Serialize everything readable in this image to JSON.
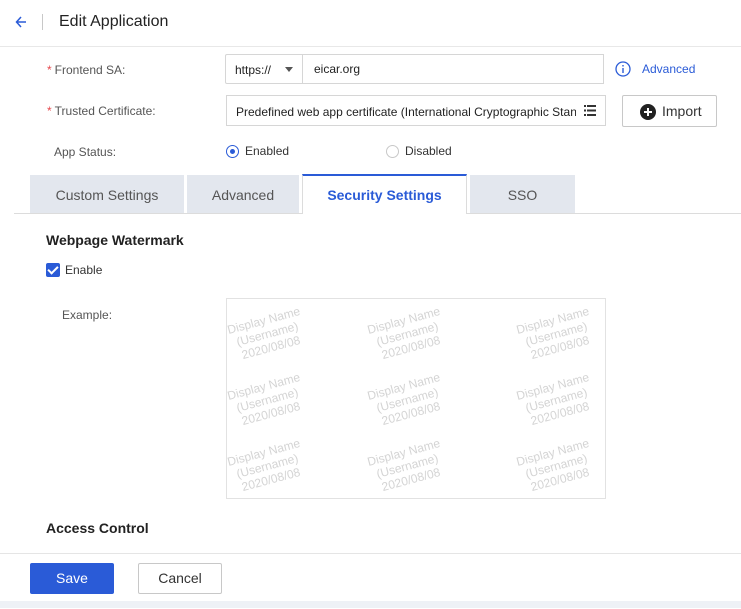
{
  "header": {
    "back_icon": "arrow-left-icon",
    "title": "Edit Application"
  },
  "form": {
    "frontend_sa": {
      "label": "Frontend SA:",
      "protocol": "https://",
      "domain": "eicar.org",
      "advanced_link": "Advanced",
      "info_icon": "info-circle-icon"
    },
    "trusted_certificate": {
      "label": "Trusted Certificate:",
      "value": "Predefined web app certificate (International Cryptographic Stan",
      "list_icon": "list-icon",
      "import_button": "Import",
      "import_icon": "plus-circle-icon"
    },
    "app_status": {
      "label": "App Status:",
      "options": [
        "Enabled",
        "Disabled"
      ],
      "selected": "Enabled"
    }
  },
  "tabs": [
    {
      "label": "Custom Settings",
      "active": false
    },
    {
      "label": "Advanced",
      "active": false
    },
    {
      "label": "Security Settings",
      "active": true
    },
    {
      "label": "SSO",
      "active": false
    }
  ],
  "watermark": {
    "section_title": "Webpage Watermark",
    "enable_label": "Enable",
    "enabled": true,
    "example_label": "Example:",
    "sample_lines": [
      "Display Name",
      "(Username)",
      "2020/08/08"
    ]
  },
  "access_control": {
    "section_title": "Access Control"
  },
  "footer": {
    "save_label": "Save",
    "cancel_label": "Cancel"
  },
  "colors": {
    "accent": "#2a5bd7",
    "required": "#e5484d",
    "tab_inactive": "#e3e7ee"
  }
}
